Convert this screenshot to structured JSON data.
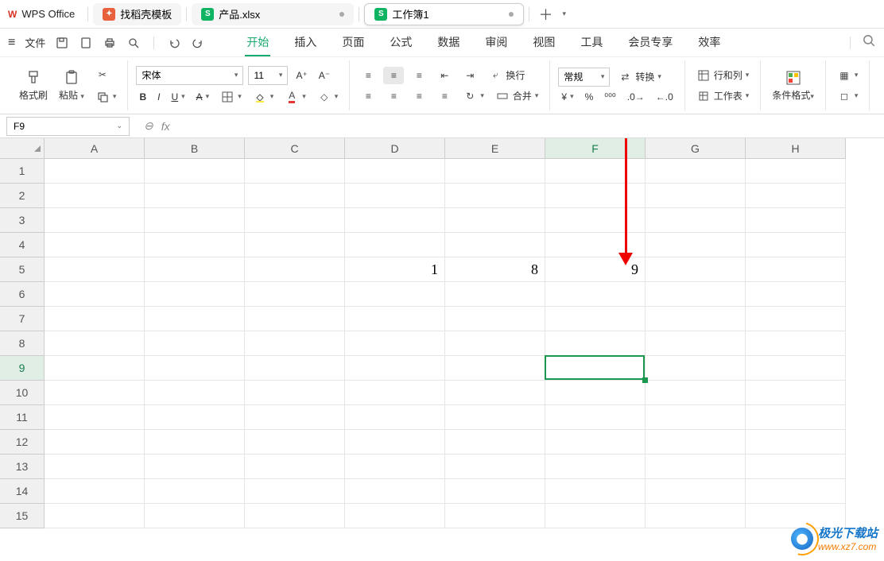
{
  "app": {
    "name": "WPS Office"
  },
  "tabs": [
    {
      "label": "找稻壳模板",
      "icon": "orange"
    },
    {
      "label": "产品.xlsx",
      "icon": "green",
      "modified": true
    },
    {
      "label": "工作簿1",
      "icon": "green",
      "modified": true,
      "active": true
    }
  ],
  "menu": {
    "file": "文件",
    "items": [
      "开始",
      "插入",
      "页面",
      "公式",
      "数据",
      "审阅",
      "视图",
      "工具",
      "会员专享",
      "效率"
    ],
    "active": "开始"
  },
  "ribbon": {
    "format_brush": "格式刷",
    "paste": "粘贴",
    "font_name": "宋体",
    "font_size": "11",
    "wrap": "换行",
    "merge": "合并",
    "number_format": "常规",
    "convert": "转换",
    "rows_cols": "行和列",
    "worksheet": "工作表",
    "cond_format": "条件格式"
  },
  "namebox": "F9",
  "formula": "",
  "columns": [
    "A",
    "B",
    "C",
    "D",
    "E",
    "F",
    "G",
    "H"
  ],
  "rows": [
    "1",
    "2",
    "3",
    "4",
    "5",
    "6",
    "7",
    "8",
    "9",
    "10",
    "11",
    "12",
    "13",
    "14",
    "15"
  ],
  "cell_data": {
    "D5": "1",
    "E5": "8",
    "F5": "9"
  },
  "selection": {
    "col": "F",
    "row": "9"
  },
  "watermark": {
    "line1": "极光下载站",
    "line2": "www.xz7.com"
  }
}
